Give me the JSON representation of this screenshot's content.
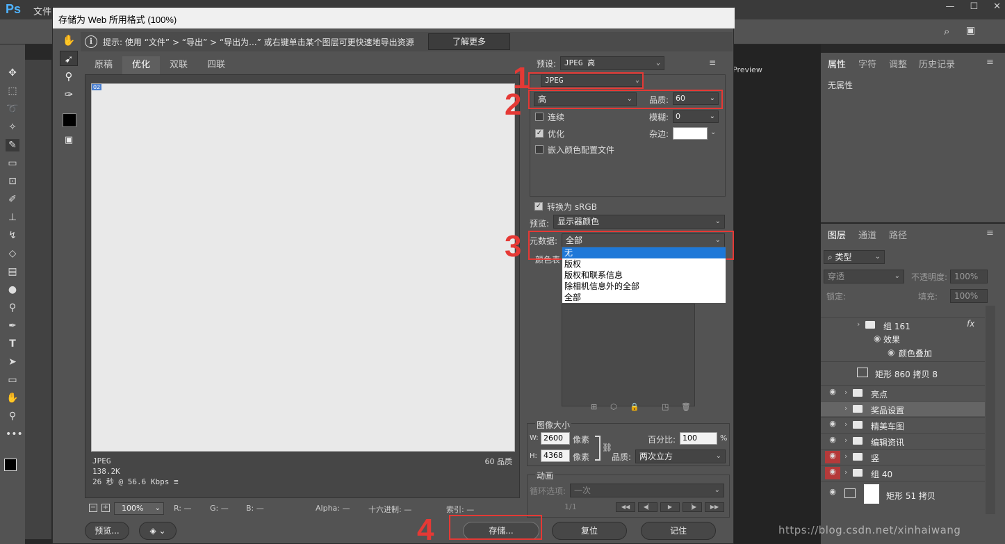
{
  "ps": {
    "logo": "Ps",
    "file_menu": "文件",
    "preview_label": "Preview",
    "win_min": "—",
    "win_max": "☐",
    "win_close": "✕"
  },
  "props_panel": {
    "tabs": [
      "属性",
      "字符",
      "调整",
      "历史记录"
    ],
    "empty_text": "无属性"
  },
  "layers_panel": {
    "tabs": [
      "图层",
      "通道",
      "路径"
    ],
    "kind_filter": "类型",
    "blend_mode": "穿透",
    "opacity_label": "不透明度:",
    "opacity_value": "100%",
    "lock_label": "锁定:",
    "fill_label": "填充:",
    "fill_value": "100%",
    "rows": [
      {
        "name": "组 161"
      },
      {
        "name": "效果"
      },
      {
        "name": "颜色叠加"
      },
      {
        "name": "矩形 860 拷贝 8"
      },
      {
        "name": "亮点"
      },
      {
        "name": "奖品设置"
      },
      {
        "name": "精美车图"
      },
      {
        "name": "编辑资讯"
      },
      {
        "name": "竖"
      },
      {
        "name": "组 40"
      },
      {
        "name": "矩形 51 拷贝"
      }
    ]
  },
  "watermark": "https://blog.csdn.net/xinhaiwang",
  "dialog": {
    "title": "存储为 Web 所用格式 (100%)",
    "hint_label": "提示:",
    "hint_text": "使用 “文件” > “导出” > “导出为...” 或右键单击某个图层可更快速地导出资源",
    "learn_more": "了解更多",
    "view_tabs": [
      "原稿",
      "优化",
      "双联",
      "四联"
    ],
    "slice_badge": "02",
    "preview_info": {
      "format": "JPEG",
      "size": "138.2K",
      "time": "26 秒 @ 56.6 Kbps",
      "quality": "60 品质"
    },
    "zoom": "100%",
    "readout": {
      "r": "R: —",
      "g": "G: —",
      "b": "B: —",
      "alpha": "Alpha: —",
      "hex": "十六进制: —",
      "index": "索引: —"
    },
    "buttons": {
      "preview": "预览...",
      "save": "存储...",
      "reset": "复位",
      "remember": "记住"
    },
    "settings": {
      "preset_label": "预设:",
      "preset_value": "JPEG 高",
      "format_value": "JPEG",
      "quality_level": "高",
      "quality_label": "品质:",
      "quality_value": "60",
      "progressive_label": "连续",
      "blur_label": "模糊:",
      "blur_value": "0",
      "optimized_label": "优化",
      "matte_label": "杂边:",
      "embed_profile_label": "嵌入颜色配置文件",
      "convert_srgb_label": "转换为 sRGB",
      "preview_label": "预览:",
      "preview_value": "显示器颜色",
      "metadata_label": "元数据:",
      "metadata_value": "全部",
      "color_table_label": "颜色表",
      "metadata_options": [
        "无",
        "版权",
        "版权和联系信息",
        "除相机信息外的全部",
        "全部"
      ],
      "highlighted_option": "无"
    },
    "image_size": {
      "title": "图像大小",
      "w_label": "W:",
      "w_value": "2600",
      "h_label": "H:",
      "h_value": "4368",
      "unit": "像素",
      "percent_label": "百分比:",
      "percent_value": "100",
      "percent_unit": "%",
      "resample_label": "品质:",
      "resample_value": "两次立方"
    },
    "animation": {
      "title": "动画",
      "loop_label": "循环选项:",
      "loop_value": "一次",
      "frame_counter": "1/1"
    }
  },
  "annotations": [
    "1",
    "2",
    "3",
    "4"
  ],
  "colors": {
    "annotation_red": "#e53935",
    "dropdown_highlight": "#1e78d8",
    "ps_blue": "#4fb3ff"
  }
}
